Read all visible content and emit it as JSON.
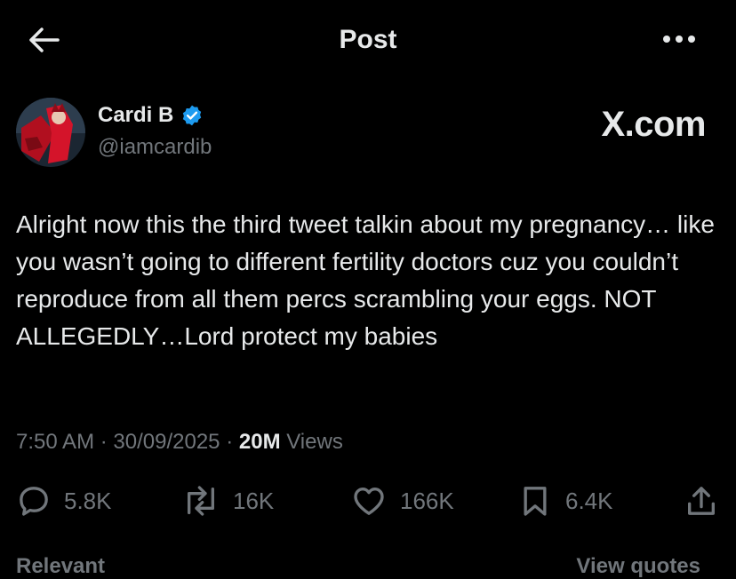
{
  "header": {
    "title": "Post",
    "back_icon": "arrow-left-icon",
    "more_icon": "more-horizontal-icon"
  },
  "author": {
    "name": "Cardi B",
    "handle": "@iamcardib",
    "verified": true,
    "verified_color": "#1d9bf0",
    "avatar_icon": "profile-avatar"
  },
  "watermark": "X.com",
  "post": {
    "text": "Alright now this the third tweet talkin about my pregnancy… like you wasn’t going to different fertility doctors cuz you couldn’t reproduce from all them percs scrambling your eggs. NOT ALLEGEDLY…Lord protect my babies",
    "time": "7:50 AM",
    "date": "30/09/2025",
    "views_count": "20M",
    "views_label": "Views",
    "separator": "·"
  },
  "actions": {
    "replies": "5.8K",
    "reposts": "16K",
    "likes": "166K",
    "bookmarks": "6.4K",
    "icons": [
      "reply-icon",
      "repost-icon",
      "like-icon",
      "bookmark-icon",
      "share-icon"
    ]
  },
  "footer": {
    "left": "Relevant",
    "right": "View quotes"
  },
  "colors": {
    "background": "#000000",
    "text": "#e7e9ea",
    "secondary": "#71767b"
  }
}
